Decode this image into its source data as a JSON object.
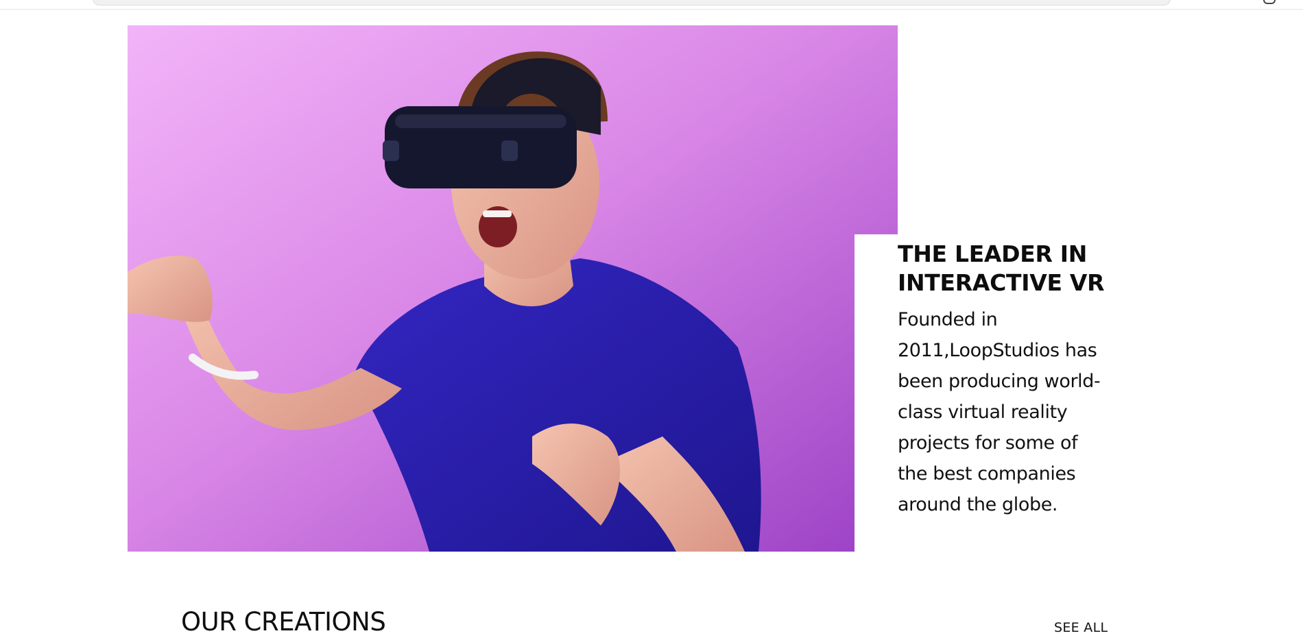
{
  "about": {
    "headline": "THE LEADER IN INTERACTIVE VR",
    "description": "Founded in 2011,LoopStudios has been producing world-class virtual reality projects for some of the best companies around the globe."
  },
  "creations": {
    "title": "OUR CREATIONS",
    "see_all_label": "SEE ALL"
  },
  "colors": {
    "hero_background": "#dc87e8",
    "shirt": "#2a1fae",
    "headset": "#15172e",
    "text": "#0d0d0d"
  }
}
